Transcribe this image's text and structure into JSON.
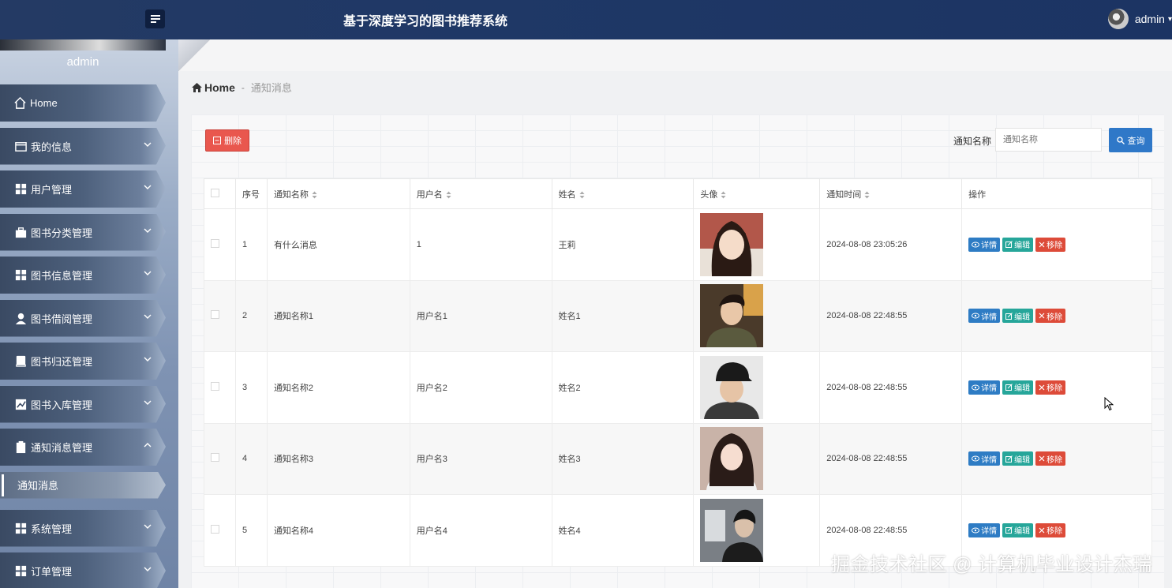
{
  "app": {
    "title": "基于深度学习的图书推荐系统"
  },
  "header_user": {
    "name": "admin",
    "caret": "▾"
  },
  "sidebar": {
    "username": "admin",
    "items": [
      {
        "label": "Home",
        "icon": "home-icon"
      },
      {
        "label": "我的信息",
        "icon": "id-card-icon"
      },
      {
        "label": "用户管理",
        "icon": "grid-icon"
      },
      {
        "label": "图书分类管理",
        "icon": "briefcase-icon"
      },
      {
        "label": "图书信息管理",
        "icon": "grid-icon"
      },
      {
        "label": "图书借阅管理",
        "icon": "user-icon"
      },
      {
        "label": "图书归还管理",
        "icon": "book-icon"
      },
      {
        "label": "图书入库管理",
        "icon": "chart-icon"
      },
      {
        "label": "通知消息管理",
        "icon": "clipboard-icon"
      },
      {
        "label": "系统管理",
        "icon": "grid-icon"
      },
      {
        "label": "订单管理",
        "icon": "grid-icon"
      }
    ],
    "sub_item": "通知消息"
  },
  "breadcrumb": {
    "home": "Home",
    "separator": "-",
    "current": "通知消息"
  },
  "toolbar": {
    "delete_label": "删除",
    "search_label": "通知名称",
    "search_placeholder": "通知名称",
    "search_button": "查询"
  },
  "table": {
    "headers": [
      "序号",
      "通知名称",
      "用户名",
      "姓名",
      "头像",
      "通知时间",
      "操作"
    ],
    "rows": [
      {
        "index": "1",
        "name": "有什么消息",
        "username": "1",
        "realname": "王莉",
        "time": "2024-08-08 23:05:26"
      },
      {
        "index": "2",
        "name": "通知名称1",
        "username": "用户名1",
        "realname": "姓名1",
        "time": "2024-08-08 22:48:55"
      },
      {
        "index": "3",
        "name": "通知名称2",
        "username": "用户名2",
        "realname": "姓名2",
        "time": "2024-08-08 22:48:55"
      },
      {
        "index": "4",
        "name": "通知名称3",
        "username": "用户名3",
        "realname": "姓名3",
        "time": "2024-08-08 22:48:55"
      },
      {
        "index": "5",
        "name": "通知名称4",
        "username": "用户名4",
        "realname": "姓名4",
        "time": "2024-08-08 22:48:55"
      }
    ],
    "actions": {
      "detail": "详情",
      "edit": "编辑",
      "remove": "移除"
    }
  },
  "watermark": "掘金技术社区 @ 计算机毕业设计杰瑞",
  "colors": {
    "header": "#1f3866",
    "delete": "#e9574e",
    "search": "#2f78c8",
    "detail": "#2e7cc4",
    "edit": "#26a69a",
    "remove": "#dd4b39"
  }
}
